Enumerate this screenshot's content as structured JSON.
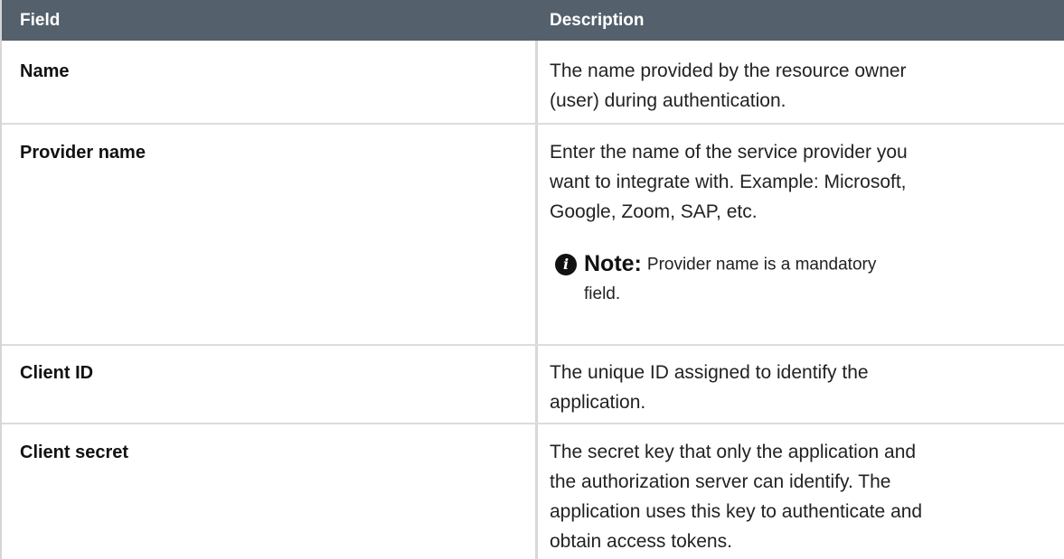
{
  "table": {
    "headers": {
      "field": "Field",
      "description": "Description"
    },
    "rows": [
      {
        "field": "Name",
        "description_lines": [
          "The name provided by the resource owner",
          "(user) during authentication."
        ]
      },
      {
        "field": "Provider name",
        "description_lines": [
          "Enter the name of the service provider you",
          "want to integrate with. Example: Microsoft,",
          "Google, Zoom, SAP, etc."
        ],
        "note": {
          "icon": "info-icon",
          "label": "Note:",
          "text_line1": "Provider name is a mandatory",
          "text_line2": "field."
        }
      },
      {
        "field": "Client ID",
        "description_lines": [
          "The unique ID assigned to identify the",
          "application."
        ]
      },
      {
        "field": "Client secret",
        "description_lines": [
          "The secret key that only the application and",
          "the authorization server can identify. The",
          "application uses this key to authenticate and",
          "obtain access tokens."
        ]
      }
    ]
  },
  "colors": {
    "header_bg": "#55606d",
    "header_text": "#ffffff",
    "divider": "#dcdcdc"
  }
}
